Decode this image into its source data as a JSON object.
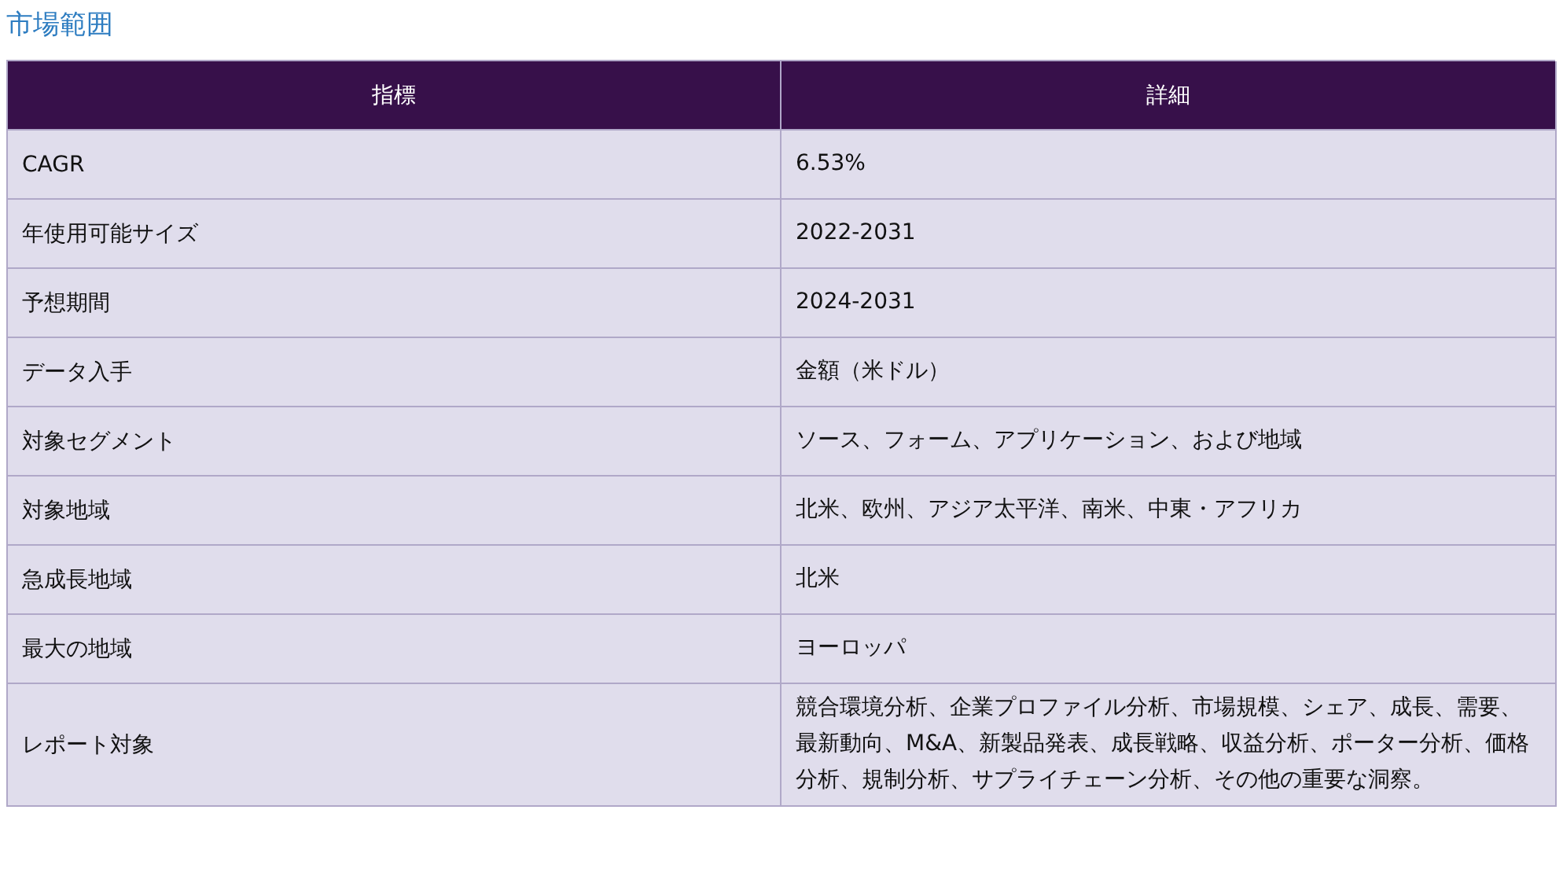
{
  "title": "市場範囲",
  "table": {
    "columns": [
      "指標",
      "詳細"
    ],
    "rows": [
      [
        "CAGR",
        "6.53%"
      ],
      [
        "年使用可能サイズ",
        "2022-2031"
      ],
      [
        "予想期間",
        "2024-2031"
      ],
      [
        "データ入手",
        "金額（米ドル）"
      ],
      [
        "対象セグメント",
        "ソース、フォーム、アプリケーション、および地域"
      ],
      [
        "対象地域",
        "北米、欧州、アジア太平洋、南米、中東・アフリカ"
      ],
      [
        "急成長地域",
        "北米"
      ],
      [
        "最大の地域",
        "ヨーロッパ"
      ],
      [
        "レポート対象",
        "競合環境分析、企業プロファイル分析、市場規模、シェア、成長、需要、最新動向、M&A、新製品発表、成長戦略、収益分析、ポーター分析、価格分析、規制分析、サプライチェーン分析、その他の重要な洞察。"
      ]
    ]
  }
}
